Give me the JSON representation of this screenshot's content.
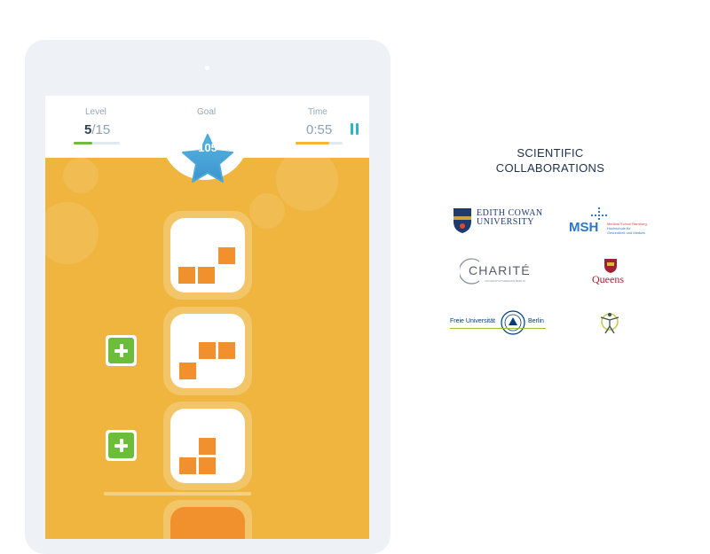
{
  "hud": {
    "level_label": "Level",
    "level_current": "5",
    "level_total": "/15",
    "level_progress": 0.4,
    "goal_label": "Goal",
    "goal_value": "105",
    "time_label": "Time",
    "time_value": "0:55",
    "time_progress": 0.72
  },
  "colors": {
    "game_background": "#f0b53f",
    "block_orange": "#f0912e",
    "plus_green": "#6cbd3a",
    "star_blue": "#4aa9d8",
    "level_bar": "#6cbd3a",
    "time_bar": "#f5b82e",
    "pause_blue": "#2ab4d6"
  },
  "icons": {
    "pause": "pause-icon",
    "star": "star-icon",
    "plus": "plus-icon"
  },
  "collaborations": {
    "title_line1": "SCIENTIFIC",
    "title_line2": "COLLABORATIONS",
    "logos": [
      {
        "id": "ecu",
        "line1": "EDITH COWAN",
        "line2": "UNIVERSITY"
      },
      {
        "id": "msh",
        "name": "MSH",
        "sub1": "Medical School Hamburg",
        "sub2": "Hochschule für",
        "sub3": "Gesundheit und Medizin"
      },
      {
        "id": "charite",
        "name": "CHARITÉ",
        "sub": "UNIVERSITÄTSMEDIZIN BERLIN"
      },
      {
        "id": "queens",
        "name": "Queens"
      },
      {
        "id": "fu",
        "left": "Freie Universität",
        "right": "Berlin"
      },
      {
        "id": "figure",
        "name": "figure-logo"
      }
    ]
  }
}
